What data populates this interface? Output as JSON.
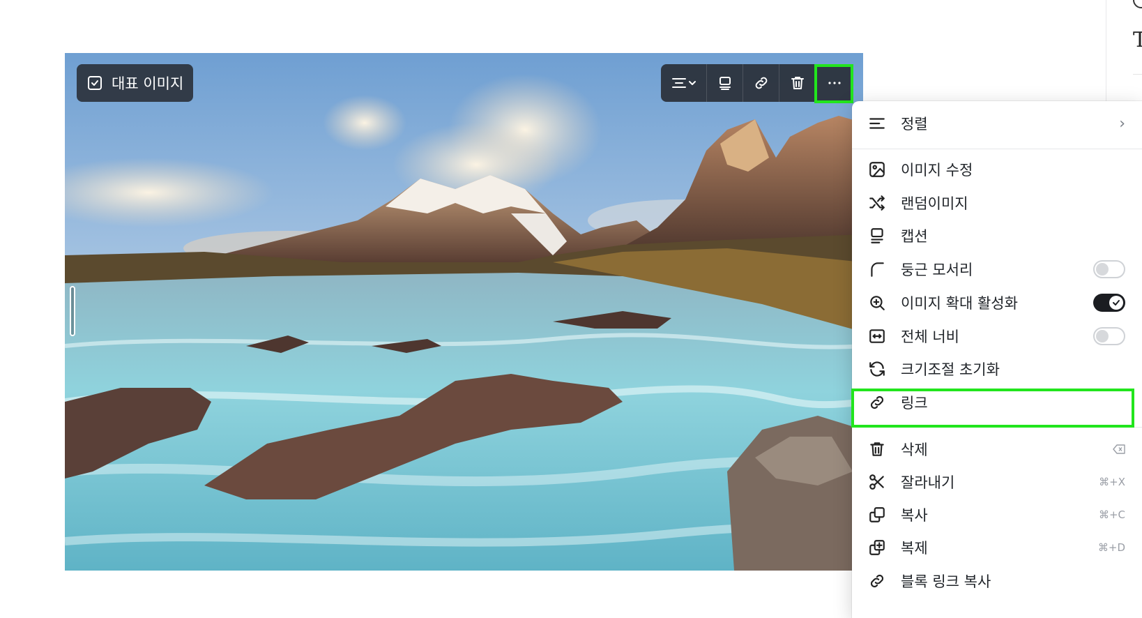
{
  "image_block": {
    "badge_label": "대표 이미지"
  },
  "toolbar": {
    "buttons": [
      "align-icon",
      "caption-icon",
      "link-icon",
      "trash-icon",
      "more-icon"
    ]
  },
  "menu": {
    "align_label": "정렬",
    "edit_image_label": "이미지 수정",
    "random_image_label": "랜덤이미지",
    "caption_label": "캡션",
    "rounded_corners_label": "둥근 모서리",
    "rounded_corners_on": false,
    "zoom_enable_label": "이미지 확대 활성화",
    "zoom_enable_on": true,
    "full_width_label": "전체 너비",
    "full_width_on": false,
    "reset_size_label": "크기조절 초기화",
    "link_label": "링크",
    "delete_label": "삭제",
    "cut_label": "잘라내기",
    "cut_shortcut": "⌘+X",
    "copy_label": "복사",
    "copy_shortcut": "⌘+C",
    "duplicate_label": "복제",
    "duplicate_shortcut": "⌘+D",
    "copy_block_link_label": "블록 링크 복사"
  },
  "colors": {
    "highlight": "#22e51d",
    "toolbar_bg": "#282c34",
    "toggle_on": "#1b1d21"
  }
}
